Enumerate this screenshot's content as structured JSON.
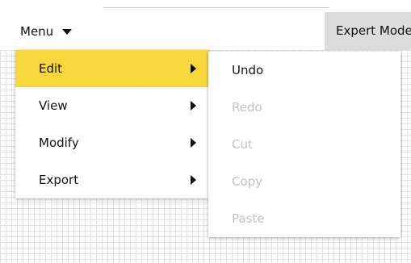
{
  "toolbar": {
    "menu_label": "Menu",
    "mode_button_label": "Expert Mode"
  },
  "dropdown": {
    "items": [
      {
        "label": "Edit",
        "active": true
      },
      {
        "label": "View",
        "active": false
      },
      {
        "label": "Modify",
        "active": false
      },
      {
        "label": "Export",
        "active": false
      }
    ]
  },
  "submenu": {
    "parent": "Edit",
    "items": [
      {
        "label": "Undo",
        "enabled": true
      },
      {
        "label": "Redo",
        "enabled": false
      },
      {
        "label": "Cut",
        "enabled": false
      },
      {
        "label": "Copy",
        "enabled": false
      },
      {
        "label": "Paste",
        "enabled": false
      }
    ]
  },
  "colors": {
    "highlight": "#f7d73b",
    "disabled_text": "#c2c2c2",
    "mode_button_bg": "#dcdcdc"
  },
  "icons": {
    "menu_caret": "caret-down-icon",
    "submenu_arrow": "chevron-right-icon"
  }
}
